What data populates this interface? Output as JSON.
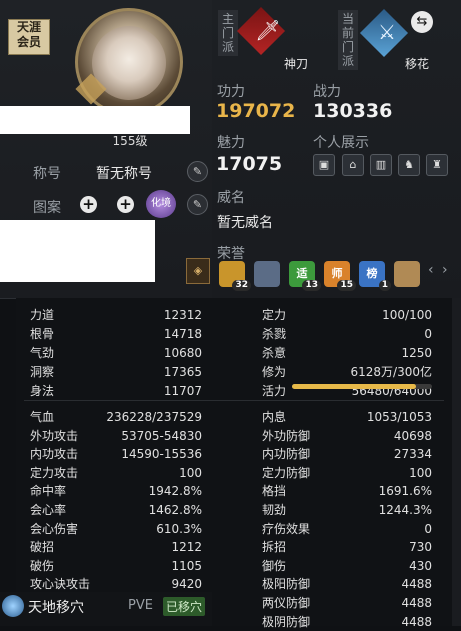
{
  "badge": "天涯\n会员",
  "level": "155级",
  "title_label": "称号",
  "title_value": "暂无称号",
  "pattern_label": "图案",
  "pattern_emblem": "化境",
  "sects": {
    "main_tag": "主门派",
    "main_name": "神刀",
    "current_tag": "当前门派",
    "current_name": "移花",
    "swap_icon": "swap-icon"
  },
  "stats_top": {
    "gongli_label": "功力",
    "gongli_value": "197072",
    "zhanli_label": "战力",
    "zhanli_value": "130336",
    "meili_label": "魅力",
    "meili_value": "17075",
    "personal_label": "个人展示",
    "weiming_label": "威名",
    "weiming_value": "暂无威名",
    "rongyu_label": "荣誉"
  },
  "honors": [
    {
      "name": "honor-1",
      "text": "",
      "count": "32",
      "color": "#c9952b"
    },
    {
      "name": "honor-2",
      "text": "",
      "count": "",
      "color": "#5b6c86"
    },
    {
      "name": "honor-3",
      "text": "适",
      "count": "13",
      "color": "#3c9a3c"
    },
    {
      "name": "honor-4",
      "text": "师",
      "count": "15",
      "color": "#d9822b"
    },
    {
      "name": "honor-5",
      "text": "榜",
      "count": "1",
      "color": "#3a73c4"
    },
    {
      "name": "honor-6",
      "text": "",
      "count": "",
      "color": "#b08a55"
    }
  ],
  "attrs_left": [
    [
      "力道",
      "12312"
    ],
    [
      "根骨",
      "14718"
    ],
    [
      "气劲",
      "10680"
    ],
    [
      "洞察",
      "17365"
    ],
    [
      "身法",
      "11707"
    ]
  ],
  "attrs_right": [
    [
      "定力",
      "100/100"
    ],
    [
      "杀戮",
      "0"
    ],
    [
      "杀意",
      "1250"
    ],
    [
      "修为",
      "6128万/300亿"
    ],
    [
      "活力",
      "56480/64000"
    ]
  ],
  "vitality_fraction": 0.8825,
  "combat_left": [
    [
      "气血",
      "236228/237529"
    ],
    [
      "外功攻击",
      "53705-54830"
    ],
    [
      "内功攻击",
      "14590-15536"
    ],
    [
      "定力攻击",
      "100"
    ],
    [
      "命中率",
      "1942.8%"
    ],
    [
      "会心率",
      "1462.8%"
    ],
    [
      "会心伤害",
      "610.3%"
    ],
    [
      "破招",
      "1212"
    ],
    [
      "破伤",
      "1105"
    ],
    [
      "攻心诀攻击",
      "9420"
    ]
  ],
  "combat_right": [
    [
      "内息",
      "1053/1053"
    ],
    [
      "外功防御",
      "40698"
    ],
    [
      "内功防御",
      "27334"
    ],
    [
      "定力防御",
      "100"
    ],
    [
      "格挡",
      "1691.6%"
    ],
    [
      "韧劲",
      "1244.3%"
    ],
    [
      "疗伤效果",
      "0"
    ],
    [
      "拆招",
      "730"
    ],
    [
      "御伤",
      "430"
    ],
    [
      "极阳防御",
      "4488"
    ],
    [
      "两仪防御",
      "4488"
    ],
    [
      "极阴防御",
      "4488"
    ]
  ],
  "footer": {
    "name": "天地移穴",
    "mode": "PVE",
    "status": "已移穴"
  }
}
